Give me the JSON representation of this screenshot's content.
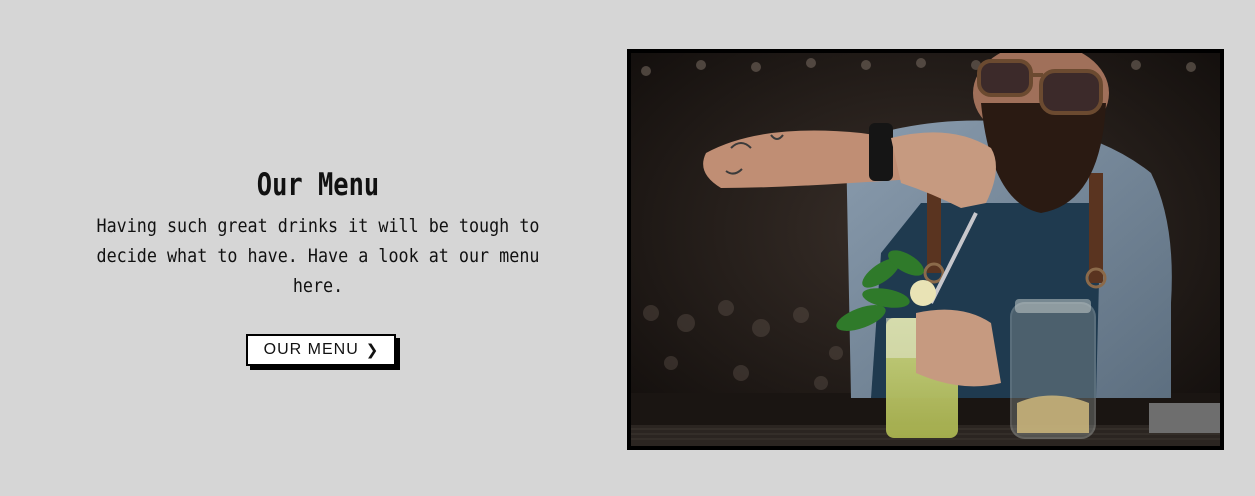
{
  "section": {
    "title": "Our Menu",
    "description": "Having such great drinks it will be tough to decide what to have. Have a look at our menu here.",
    "button_label": "OUR MENU",
    "button_icon": "chevron-right-icon"
  },
  "photo": {
    "subject": "bartender-preparing-cocktail"
  },
  "colors": {
    "background": "#d6d6d6",
    "text": "#111111",
    "frame": "#000000",
    "button_bg": "#ffffff"
  }
}
